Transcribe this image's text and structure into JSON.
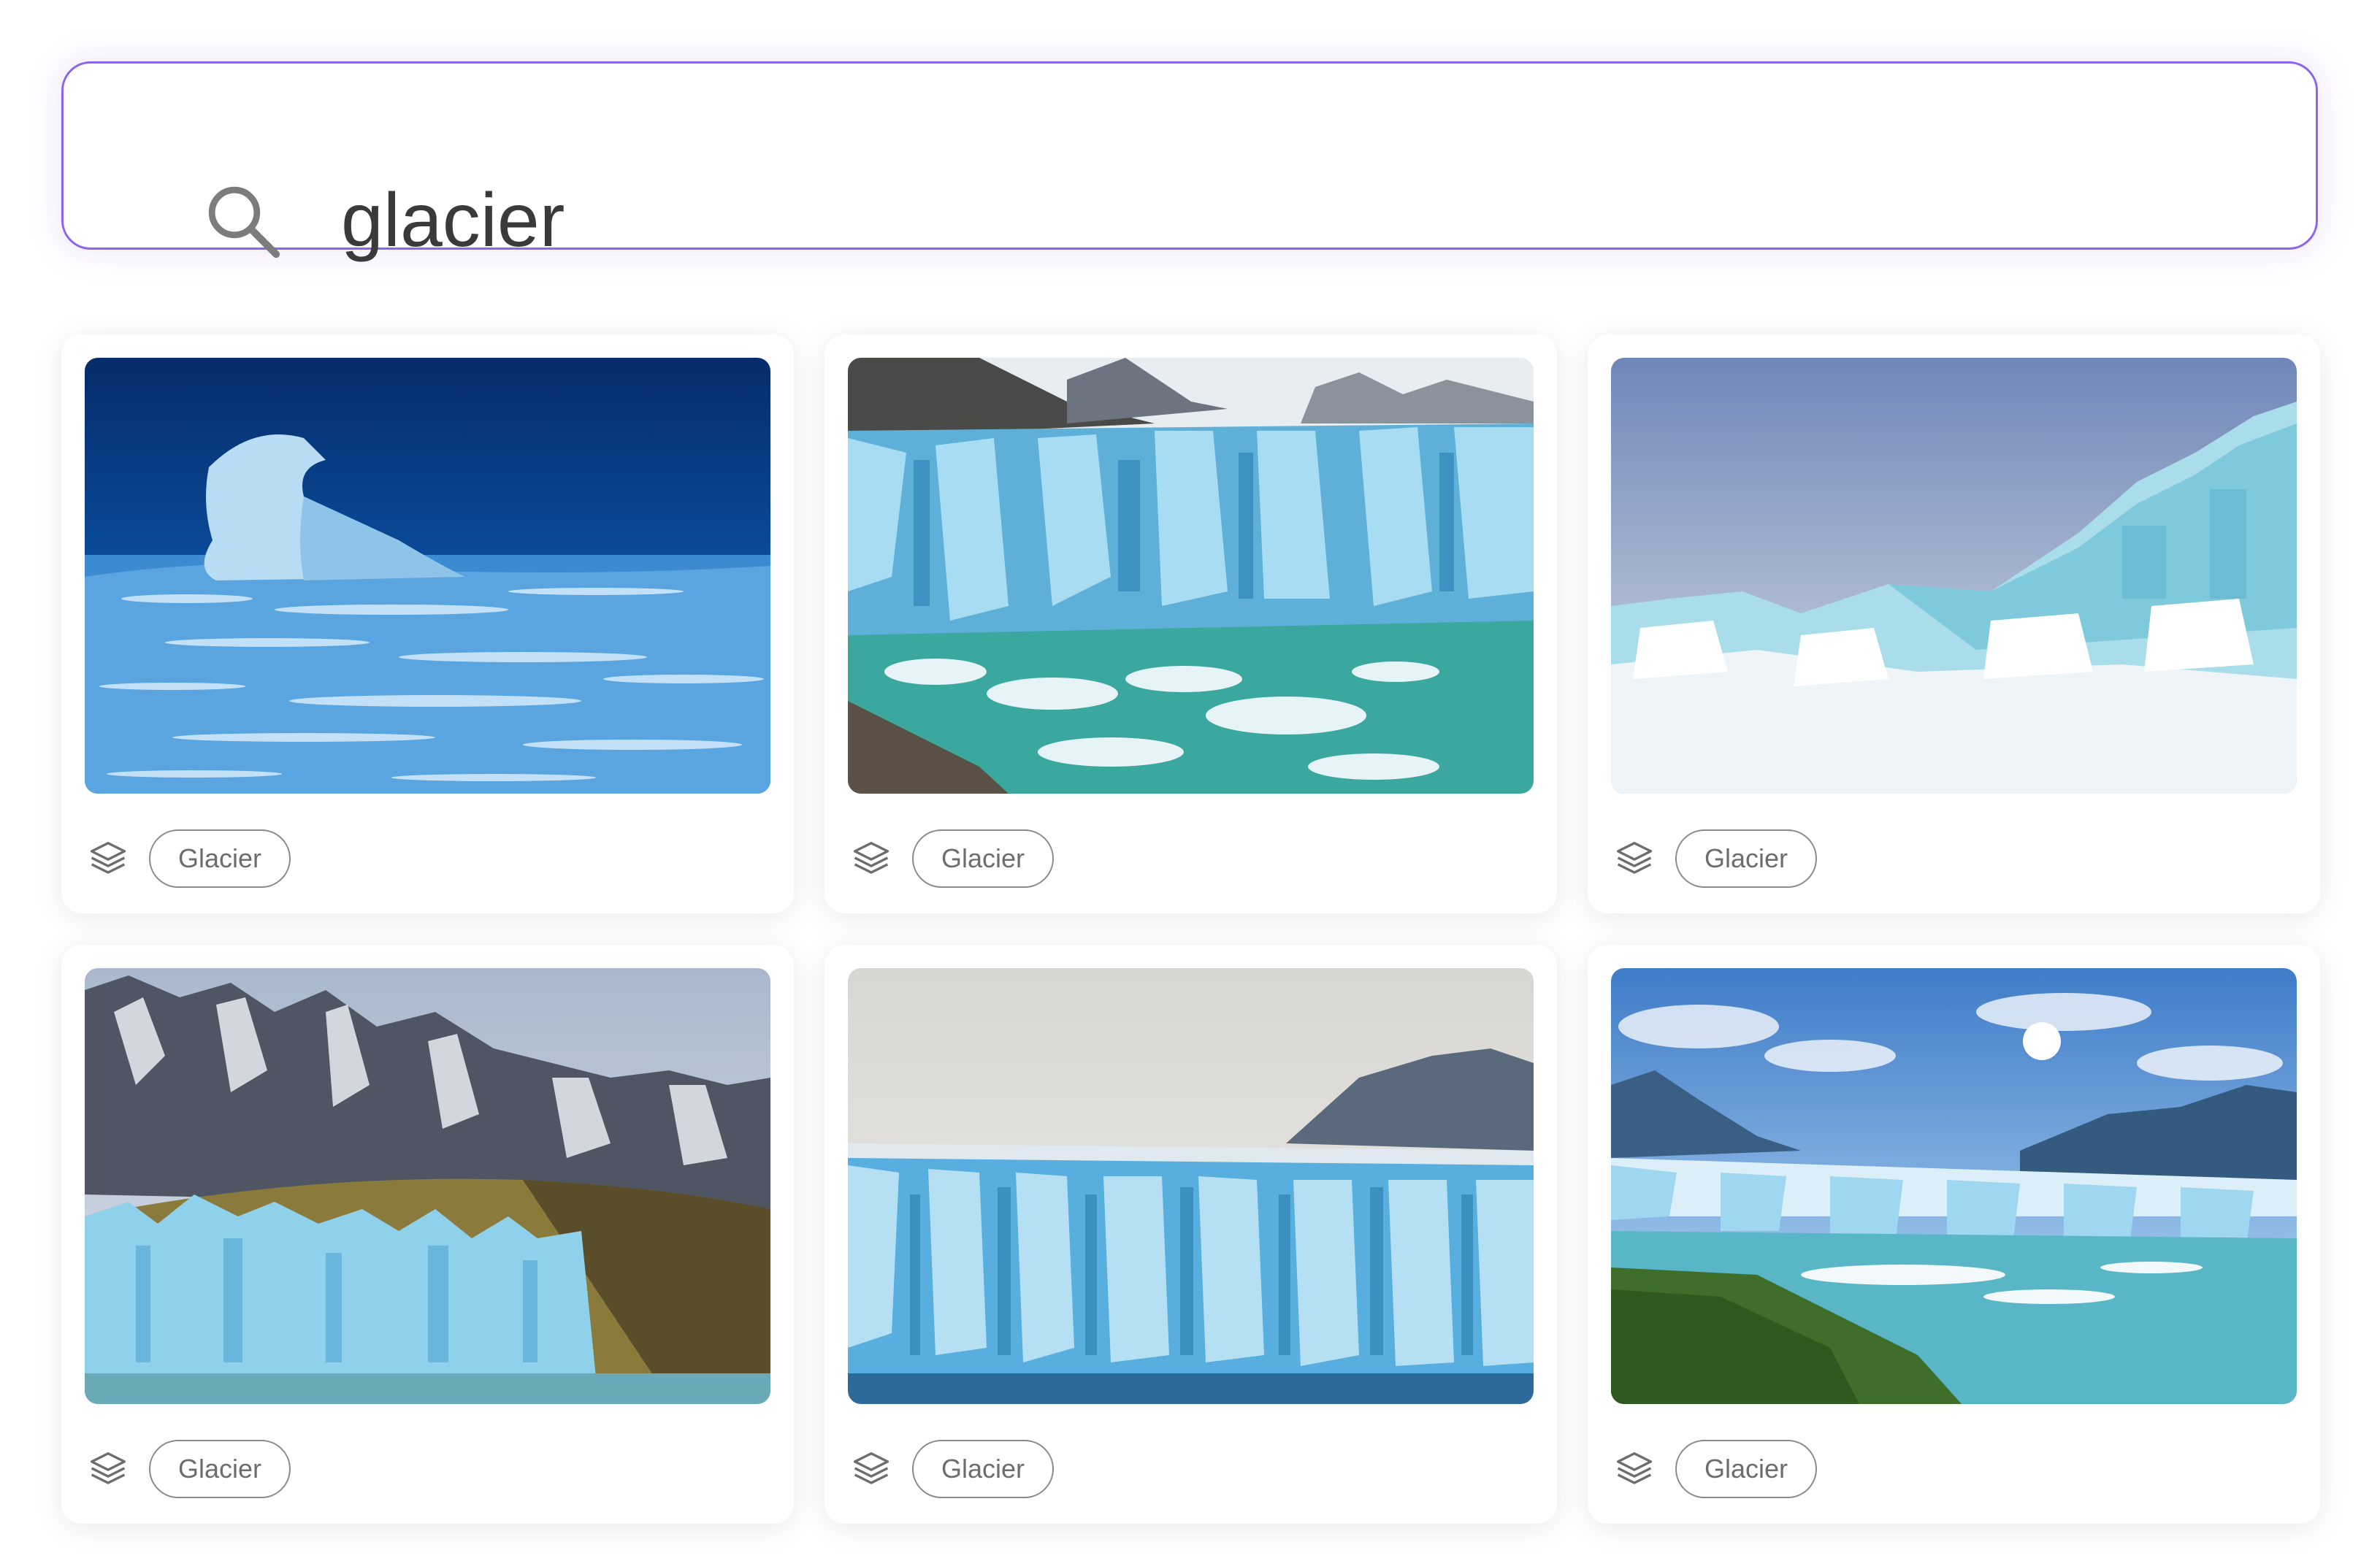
{
  "search": {
    "value": "glacier",
    "icon": "search-icon"
  },
  "accent_color": "#8b64f0",
  "results": [
    {
      "tag": "Glacier",
      "image": "iceberg-in-dark-blue-water"
    },
    {
      "tag": "Glacier",
      "image": "glacier-wall-with-mountains"
    },
    {
      "tag": "Glacier",
      "image": "ice-field-under-pale-sky"
    },
    {
      "tag": "Glacier",
      "image": "glacier-below-snowy-peaks"
    },
    {
      "tag": "Glacier",
      "image": "blue-glacier-front-misty-sky"
    },
    {
      "tag": "Glacier",
      "image": "glacier-lake-with-forest"
    }
  ]
}
